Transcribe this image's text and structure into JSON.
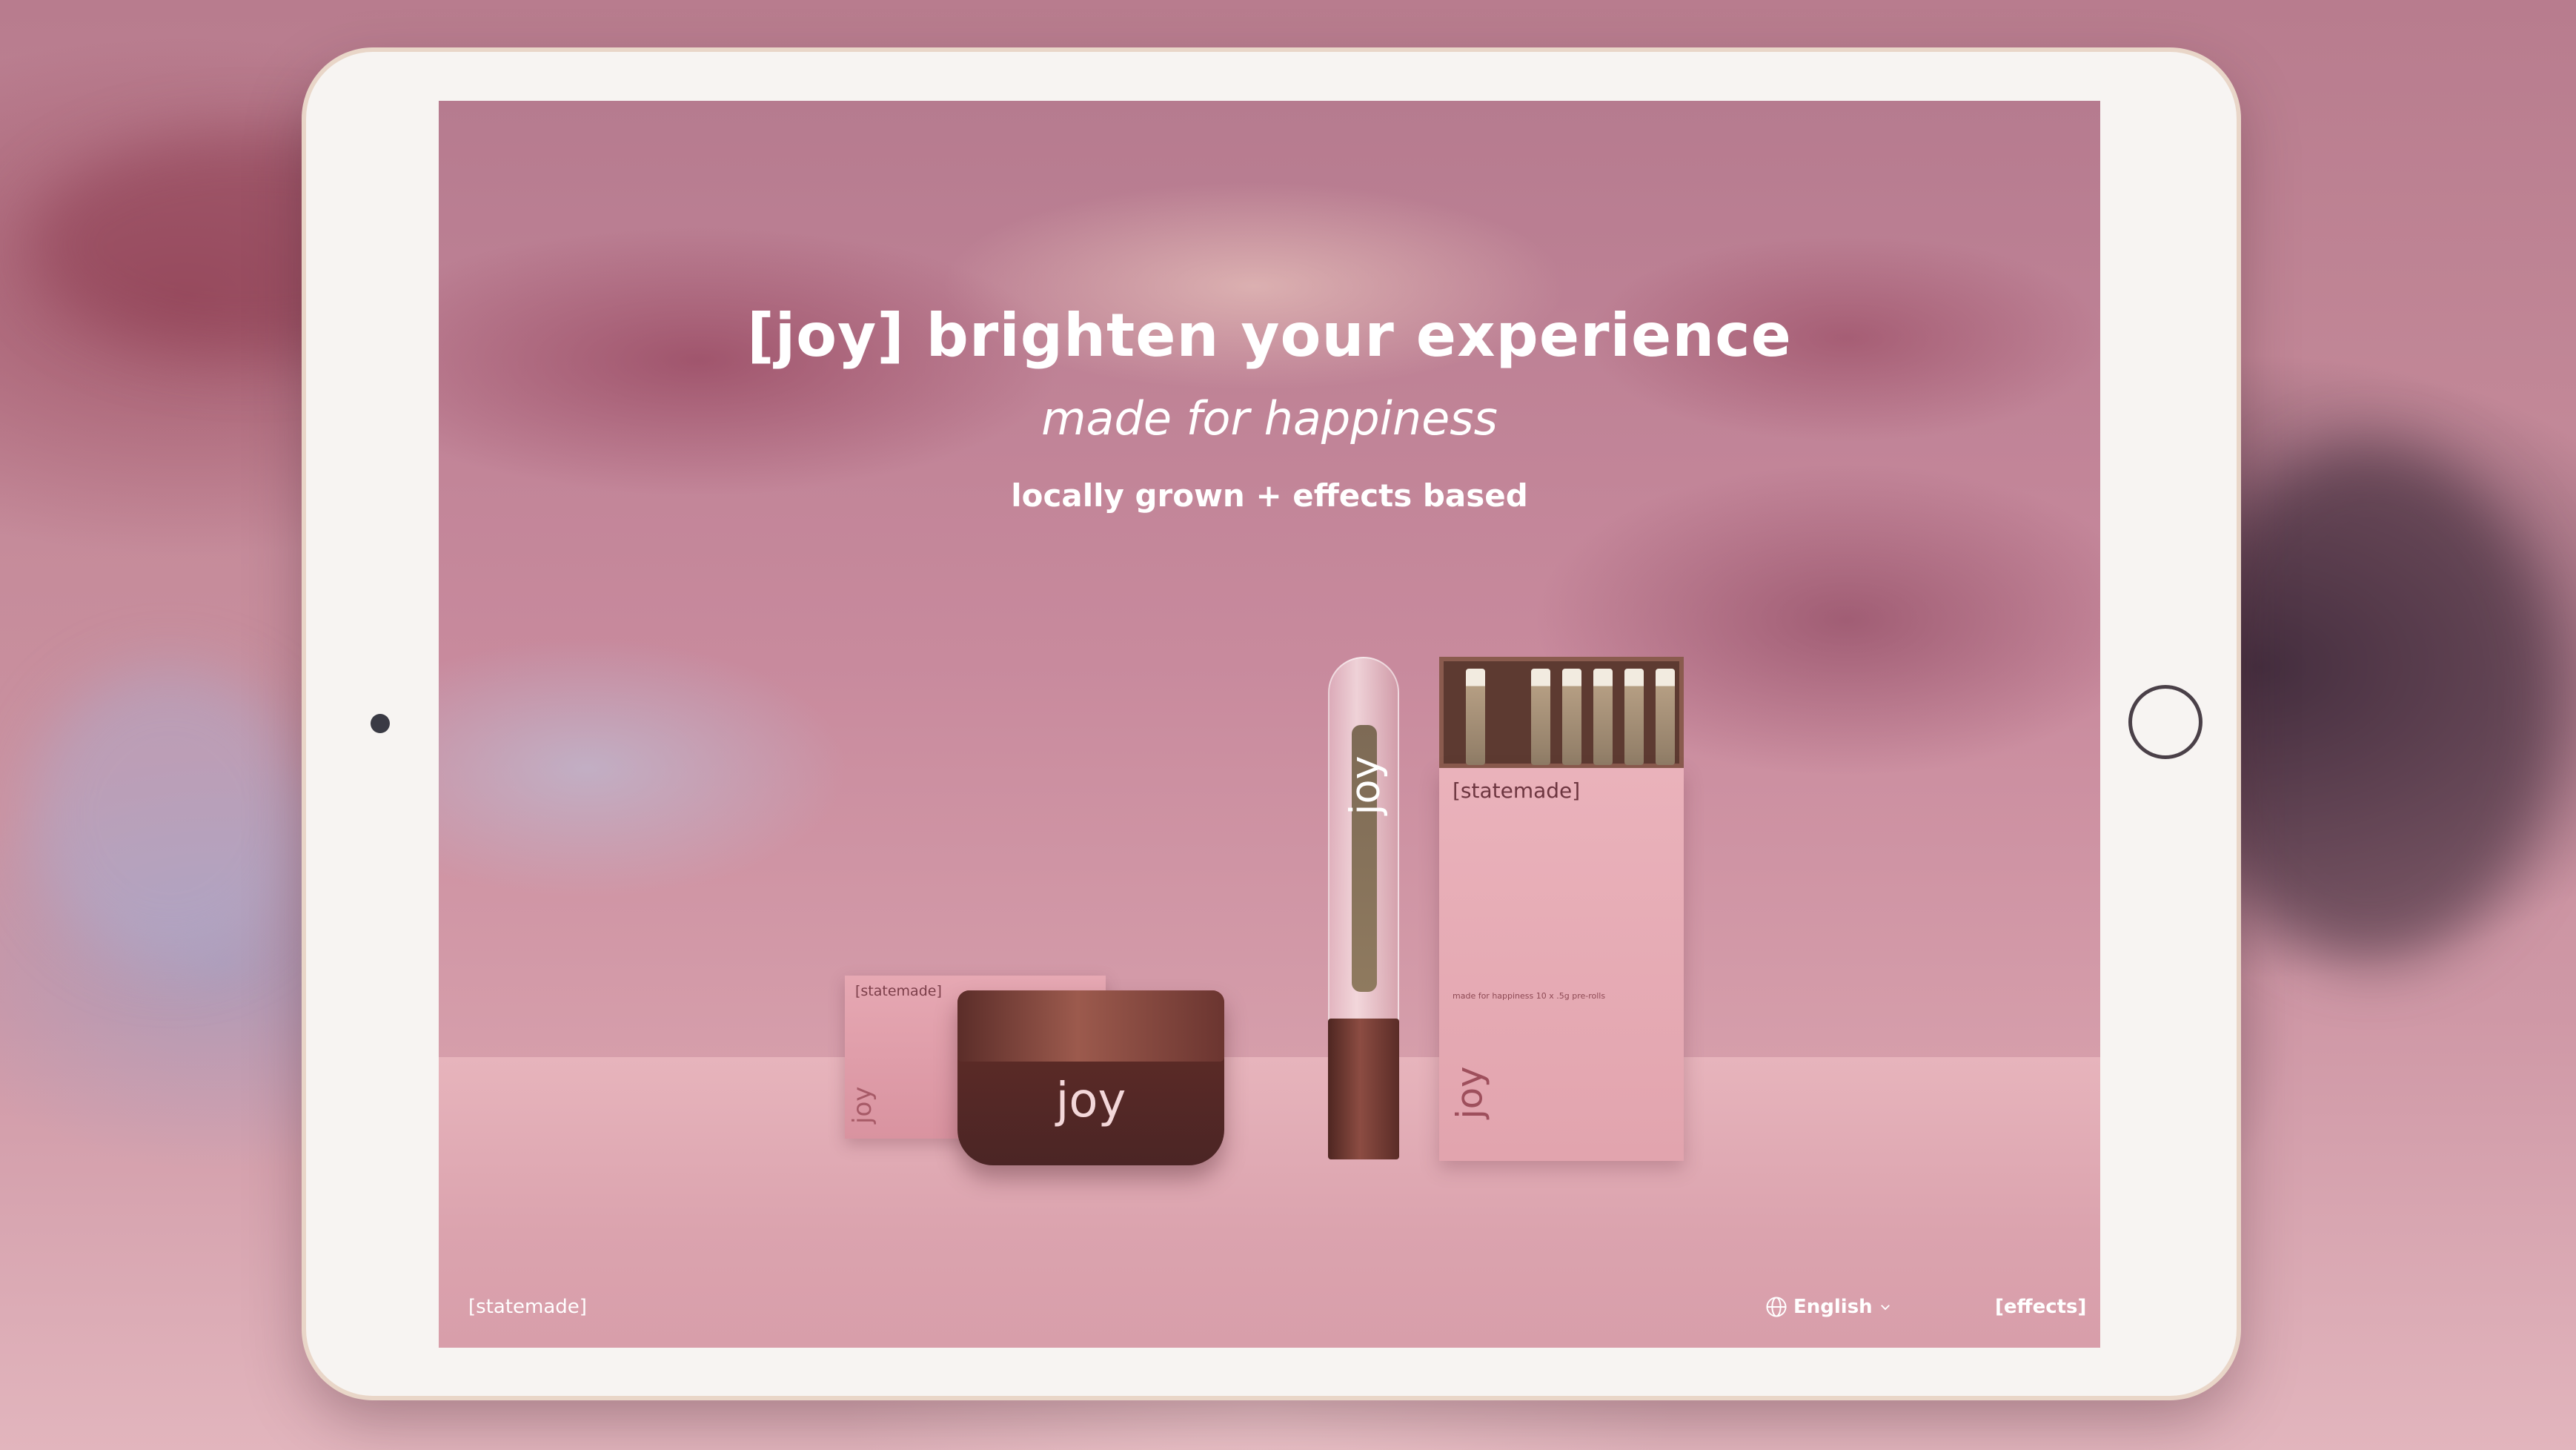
{
  "hero": {
    "title": "[joy] brighten your experience",
    "subtitle": "made for happiness",
    "tagline": "locally grown + effects based"
  },
  "products": {
    "small_box_brand": "[statemade]",
    "small_box_label": "joy",
    "jar_label": "joy",
    "tube_label": "joy",
    "box_brand": "[statemade]",
    "box_small_text": "made for happiness\n10 x .5g pre-rolls",
    "box_label": "joy"
  },
  "footer": {
    "brand_link": "[statemade]",
    "language_icon": "globe-icon",
    "language_label": "English",
    "language_caret": "chevron-down-icon",
    "effects_link": "[effects]"
  },
  "colors": {
    "accent_pink": "#dfa9b5",
    "text": "#ffffff",
    "product_brown": "#5a2a26"
  }
}
